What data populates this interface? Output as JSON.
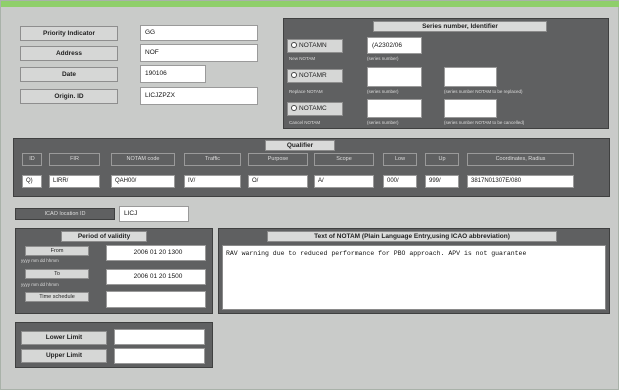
{
  "form": {
    "priority_label": "Priority Indicator",
    "priority_value": "GG",
    "address_label": "Address",
    "address_value": "NOF",
    "date_label": "Date",
    "date_value": "190106",
    "origin_label": "Origin. ID",
    "origin_value": "LICJZPZX"
  },
  "series": {
    "title": "Series number, Identifier",
    "notamn_label": "NOTAMN",
    "notamn_value": "(A2302/06",
    "notamn_sub": "New NOTAM",
    "notamn_note": "(series number)",
    "notamr_label": "NOTAMR",
    "notamr_sub": "Replace NOTAM",
    "notamr_note1": "(series number)",
    "notamr_note2": "(series number NOTAM to be replaced)",
    "notamc_label": "NOTAMC",
    "notamc_sub": "Cancel NOTAM",
    "notamc_note1": "(series number)",
    "notamc_note2": "(series number NOTAM to be cancelled)"
  },
  "qualifier": {
    "title": "Qualifier",
    "headers": [
      "ID",
      "FIR",
      "NOTAM code",
      "Traffic",
      "Purpose",
      "Scope",
      "Low",
      "Up",
      "Coordinates, Radius"
    ],
    "values": [
      "Q)",
      "LIRR/",
      "QAH00/",
      "IV/",
      "O/",
      "A/",
      "000/",
      "999/",
      "3817N01307E/080"
    ]
  },
  "icao": {
    "label": "ICAO location ID",
    "value": "LICJ"
  },
  "validity": {
    "title": "Period of validity",
    "from_label": "From",
    "from_format": "yyyy mm dd hhmm",
    "from_value": "2006 01 20 1300",
    "to_label": "To",
    "to_format": "yyyy mm dd hhmm",
    "to_value": "2006 01 20 1500",
    "schedule_label": "Time schedule",
    "schedule_value": ""
  },
  "notam_text": {
    "title": "Text of NOTAM (Plain Language Entry,using ICAO abbreviation)",
    "value": "RAV warning due to reduced performance for PBO approach. APV is not guarantee"
  },
  "limits": {
    "lower_label": "Lower Limit",
    "lower_value": "",
    "upper_label": "Upper Limit",
    "upper_value": ""
  }
}
